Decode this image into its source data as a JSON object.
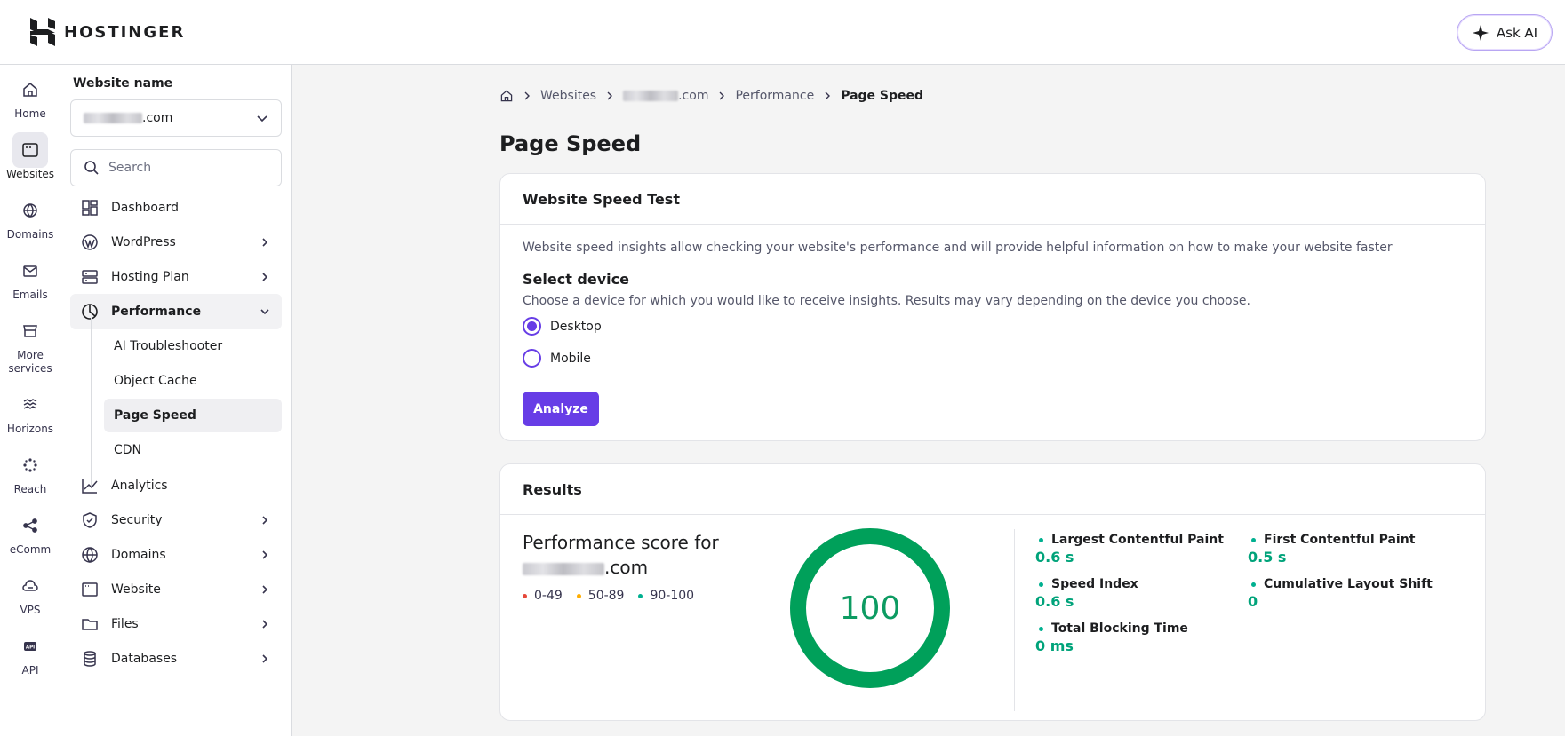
{
  "brand": {
    "name": "HOSTINGER"
  },
  "header": {
    "ask_ai_label": "Ask AI"
  },
  "rail": [
    {
      "label": "Home",
      "icon": "home-icon"
    },
    {
      "label": "Websites",
      "icon": "browser-icon"
    },
    {
      "label": "Domains",
      "icon": "globe-icon"
    },
    {
      "label": "Emails",
      "icon": "mail-icon"
    },
    {
      "label": "More services",
      "icon": "store-icon"
    },
    {
      "label": "Horizons",
      "icon": "waves-icon"
    },
    {
      "label": "Reach",
      "icon": "sparkle-icon"
    },
    {
      "label": "eComm",
      "icon": "share-icon"
    },
    {
      "label": "VPS",
      "icon": "cloud-icon"
    },
    {
      "label": "API",
      "icon": "api-icon"
    }
  ],
  "sidebar": {
    "title": "Website name",
    "site_suffix": ".com",
    "search_placeholder": "Search",
    "items": [
      {
        "label": "Dashboard"
      },
      {
        "label": "WordPress"
      },
      {
        "label": "Hosting Plan"
      },
      {
        "label": "Performance"
      },
      {
        "label": "AI Troubleshooter"
      },
      {
        "label": "Object Cache"
      },
      {
        "label": "Page Speed"
      },
      {
        "label": "CDN"
      },
      {
        "label": "Analytics"
      },
      {
        "label": "Security"
      },
      {
        "label": "Domains"
      },
      {
        "label": "Website"
      },
      {
        "label": "Files"
      },
      {
        "label": "Databases"
      }
    ]
  },
  "breadcrumb": {
    "websites": "Websites",
    "site_suffix": ".com",
    "performance": "Performance",
    "current": "Page Speed"
  },
  "page": {
    "title": "Page Speed"
  },
  "speed_test": {
    "title": "Website Speed Test",
    "description": "Website speed insights allow checking your website's performance and will provide helpful information on how to make your website faster",
    "select_title": "Select device",
    "select_description": "Choose a device for which you would like to receive insights. Results may vary depending on the device you choose.",
    "options": [
      {
        "label": "Desktop",
        "selected": true
      },
      {
        "label": "Mobile",
        "selected": false
      }
    ],
    "analyze_label": "Analyze"
  },
  "results": {
    "title": "Results",
    "score_title_line1": "Performance score for",
    "score_title_suffix": ".com",
    "score": "100",
    "score_fraction": 1.0,
    "legend": [
      {
        "label": "0-49",
        "color": "#e5483a"
      },
      {
        "label": "50-89",
        "color": "#ffad00"
      },
      {
        "label": "90-100",
        "color": "#00b090"
      }
    ],
    "metrics": [
      {
        "label": "Largest Contentful Paint",
        "value": "0.6 s"
      },
      {
        "label": "First Contentful Paint",
        "value": "0.5 s"
      },
      {
        "label": "Speed Index",
        "value": "0.6 s"
      },
      {
        "label": "Cumulative Layout Shift",
        "value": "0"
      },
      {
        "label": "Total Blocking Time",
        "value": "0 ms"
      }
    ]
  },
  "colors": {
    "accent": "#673de6",
    "good": "#00a05a"
  }
}
